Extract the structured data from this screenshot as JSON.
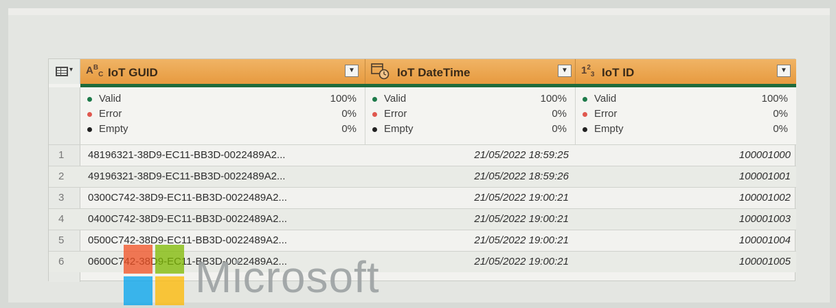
{
  "columns": [
    {
      "type_icon": "ABC",
      "title": "IoT GUID"
    },
    {
      "type_icon": "clock",
      "title": "IoT DateTime"
    },
    {
      "type_icon": "123",
      "title": "IoT ID"
    }
  ],
  "quality": {
    "labels": [
      "Valid",
      "Error",
      "Empty"
    ],
    "colors": [
      "#1e7a4a",
      "#e0584f",
      "#222222"
    ],
    "guid": [
      "100%",
      "0%",
      "0%"
    ],
    "datetime": [
      "100%",
      "0%",
      "0%"
    ],
    "id": [
      "100%",
      "0%",
      "0%"
    ]
  },
  "rows": [
    {
      "n": "1",
      "guid": "48196321-38D9-EC11-BB3D-0022489A2...",
      "dt": "21/05/2022 18:59:25",
      "id": "100001000"
    },
    {
      "n": "2",
      "guid": "49196321-38D9-EC11-BB3D-0022489A2...",
      "dt": "21/05/2022 18:59:26",
      "id": "100001001"
    },
    {
      "n": "3",
      "guid": "0300C742-38D9-EC11-BB3D-0022489A2...",
      "dt": "21/05/2022 19:00:21",
      "id": "100001002"
    },
    {
      "n": "4",
      "guid": "0400C742-38D9-EC11-BB3D-0022489A2...",
      "dt": "21/05/2022 19:00:21",
      "id": "100001003"
    },
    {
      "n": "5",
      "guid": "0500C742-38D9-EC11-BB3D-0022489A2...",
      "dt": "21/05/2022 19:00:21",
      "id": "100001004"
    },
    {
      "n": "6",
      "guid": "0600C742-38D9-EC11-BB3D-0022489A2...",
      "dt": "21/05/2022 19:00:21",
      "id": "100001005"
    }
  ],
  "watermark": {
    "text": "Microsoft",
    "logo_colors": [
      "#f25022",
      "#7fba00",
      "#00a4ef",
      "#ffb900"
    ]
  }
}
